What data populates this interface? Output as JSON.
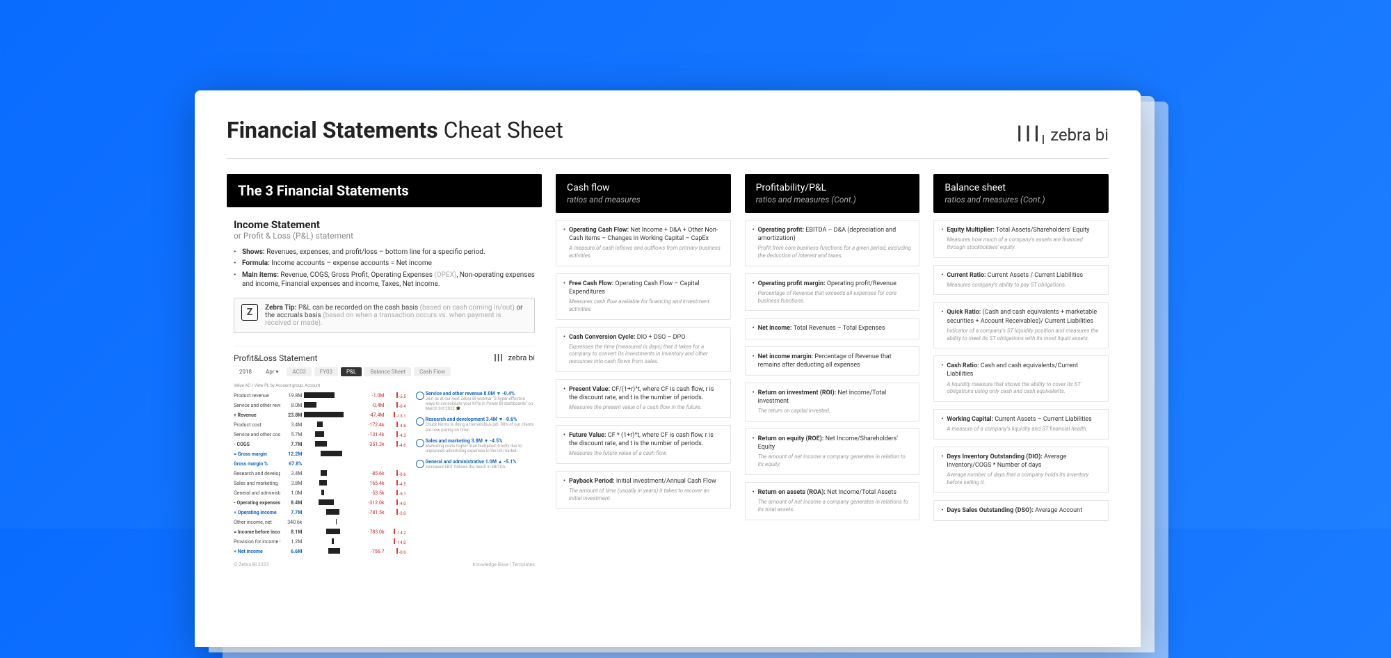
{
  "header": {
    "bold": "Financial Statements",
    "light": "Cheat Sheet"
  },
  "brand": "zebra bi",
  "left": {
    "bannerTitle": "The 3 Financial Statements",
    "incomeTitle": "Income Statement",
    "incomeAlt": "or Profit & Loss (P&L) statement",
    "b1Label": "Shows:",
    "b1Text": "Revenues, expenses, and profit/loss – bottom line for a specific period.",
    "b2Label": "Formula:",
    "b2Text": "Income accounts – expense accounts = Net income",
    "b3Label": "Main items:",
    "b3Text": "Revenue, COGS, Gross Profit, Operating Expenses ",
    "b3Dim": "(OPEX)",
    "b3Tail": ", Non-operating expenses and income, Financial expenses and income, Taxes, Net income.",
    "tipLabel": "Zebra Tip:",
    "tipText1": "P&L can be recorded on the cash basis ",
    "tipDim1": "(based on cash coming in/out)",
    "tipText2": " or the accruals basis ",
    "tipDim2": "(based on when a transaction occurs vs. when payment is received or made).",
    "chartTitle": "Profit&Loss Statement",
    "chartYear": "2018",
    "tabs": [
      "AC03",
      "FY03",
      "P&L",
      "Balance Sheet",
      "Cash Flow"
    ],
    "chartHdr": "Value AC / View PL by Account group, Account",
    "footerLeft": "© Zebra BI 2022",
    "footerRight": "Knowledge Base  |  Templates"
  },
  "tableRows": [
    {
      "label": "Product revenue",
      "ac": "19.8M",
      "bar": 55,
      "bpos": 0,
      "var": "-1.0M",
      "pct": "-5.5",
      "cls": "neg",
      "bold": false
    },
    {
      "label": "Service and other revenue",
      "ac": "8.0M",
      "bar": 22,
      "bpos": 0,
      "var": "-0.4M",
      "pct": "-0.4",
      "cls": "neg",
      "bold": false
    },
    {
      "label": "+ Revenue",
      "ac": "23.8M",
      "bar": 72,
      "bpos": 0,
      "var": "-47.4M",
      "pct": "-13.1",
      "cls": "neg",
      "bold": true
    },
    {
      "label": "Product cost",
      "ac": "3.4M",
      "bar": 10,
      "bpos": 24,
      "var": "-172.4k",
      "pct": "-4.8",
      "cls": "neg",
      "bold": false
    },
    {
      "label": "Service and other costs",
      "ac": "5.7M",
      "bar": 16,
      "bpos": 20,
      "var": "-131.4k",
      "pct": "-4.3",
      "cls": "neg",
      "bold": false
    },
    {
      "label": "- COGS",
      "ac": "7.7M",
      "bar": 22,
      "bpos": 20,
      "var": "-351.3k",
      "pct": "-4.6",
      "cls": "neg",
      "bold": true
    },
    {
      "label": "= Gross margin",
      "ac": "12.2M",
      "bar": 40,
      "bpos": 30,
      "var": "",
      "pct": "",
      "cls": "",
      "bold": true,
      "blue": true
    },
    {
      "label": "Gross margin %",
      "ac": "67.8%",
      "bar": 0,
      "bpos": 0,
      "var": "",
      "pct": "",
      "cls": "",
      "bold": false,
      "blue": true
    },
    {
      "label": "Research and development",
      "ac": "3.4M",
      "bar": 12,
      "bpos": 30,
      "var": "-85.6k",
      "pct": "-0.6",
      "cls": "neg",
      "bold": false
    },
    {
      "label": "Sales and marketing",
      "ac": "3.8M",
      "bar": 13,
      "bpos": 28,
      "var": "165.4k",
      "pct": "-4.5",
      "cls": "neg",
      "bold": false
    },
    {
      "label": "General and administrative",
      "ac": "1.0M",
      "bar": 4,
      "bpos": 32,
      "var": "-53.5k",
      "pct": "-5.1",
      "cls": "neg",
      "bold": false
    },
    {
      "label": "- Operating expenses",
      "ac": "8.4M",
      "bar": 28,
      "bpos": 26,
      "var": "-312.0k",
      "pct": "-4.0",
      "cls": "neg",
      "bold": true
    },
    {
      "label": "= Operating income",
      "ac": "7.7M",
      "bar": 24,
      "bpos": 40,
      "var": "-781.5k",
      "pct": "-2.0",
      "cls": "neg",
      "bold": true,
      "blue": true
    },
    {
      "label": "Other income, net",
      "ac": "340.6k",
      "bar": 2,
      "bpos": 58,
      "var": "",
      "pct": "",
      "cls": "",
      "bold": false
    },
    {
      "label": "= Income before income taxes",
      "ac": "8.1M",
      "bar": 26,
      "bpos": 40,
      "var": "-783.0k",
      "pct": "-14.2",
      "cls": "neg",
      "bold": true
    },
    {
      "label": "Provision for income taxes",
      "ac": "1.2M",
      "bar": 4,
      "bpos": 50,
      "var": "",
      "pct": "-14.0",
      "cls": "neg",
      "bold": false
    },
    {
      "label": "= Net income",
      "ac": "6.6M",
      "bar": 22,
      "bpos": 44,
      "var": "-756.7",
      "pct": "-0.6",
      "cls": "neg",
      "bold": true,
      "blue": true
    }
  ],
  "annotations": [
    {
      "t": "Service and other revenue 8.0M ▼ -0.4%",
      "d": "Join us at our next Zebra BI webinar \"3 hyper-effective ways to consolidate your KPIs in Power BI dashboards\" on March 3rd 2022 🎓"
    },
    {
      "t": "Research and development 3.4M ▼ -0.6%",
      "d": "Chuck Norris is doing a tremendous job. 98% of our clients are now paying on time!"
    },
    {
      "t": "Sales and marketing 3.8M ▼ -4.5%",
      "d": "Marketing costs higher than budgeted mostly due to unplanned advertising expenses in the US market."
    },
    {
      "t": "General and administrative 1.0M ▲ -5.1%",
      "d": "Increased EBIT follows the result in EBITDA."
    }
  ],
  "col2": {
    "title": "Cash flow",
    "sub": "ratios and measures",
    "cards": [
      {
        "term": "Operating Cash Flow:",
        "def": "Net Income + D&A + Other Non-Cash items – Changes in Working Capital – CapEx",
        "desc": "A measure of cash inflows and outflows from primary business activities."
      },
      {
        "term": "Free Cash Flow:",
        "def": "Operating Cash Flow – Capital Expenditures",
        "desc": "Measures cash flow available for financing and investment activities."
      },
      {
        "term": "Cash Conversion Cycle:",
        "def": "DIO + DSO – DPO",
        "desc": "Expresses the time (measured in days) that it takes for a company to convert its investments in inventory and other resources into cash flows from sales."
      },
      {
        "term": "Present Value:",
        "def": "CF/(1+r)^t, where CF is cash flow, r is the discount rate, and t is the number of periods.",
        "desc": "Measures the present value of a cash flow in the future."
      },
      {
        "term": "Future Value:",
        "def": "CF * (1+r)^t, where CF is cash flow, r is the discount rate, and t is the number of periods.",
        "desc": "Measures the future value of a cash flow."
      },
      {
        "term": "Payback Period:",
        "def": "Initial investment/Annual Cash Flow",
        "desc": "The amount of time (usually in years) it takes to recover an initial investment."
      }
    ]
  },
  "col3": {
    "title": "Profitability/P&L",
    "sub": "ratios and measures (Cont.)",
    "cards": [
      {
        "term": "Operating profit:",
        "def": "EBITDA – D&A (depreciation and amortization)",
        "desc": "Profit from core business functions for a given period, excluding the deduction of interest and taxes."
      },
      {
        "term": "Operating profit margin:",
        "def": "Operating profit/Revenue",
        "desc": "Percentage of Revenue that exceeds all expenses for core business functions."
      },
      {
        "term": "Net income:",
        "def": "Total Revenues – Total Expenses",
        "desc": ""
      },
      {
        "term": "Net income margin:",
        "def": "Percentage of Revenue that remains after deducting all expenses",
        "desc": ""
      },
      {
        "term": "Return on investment (ROI):",
        "def": "Net income/Total investment",
        "desc": "The return on capital invested."
      },
      {
        "term": "Return on equity (ROE):",
        "def": "Net Income/Shareholders' Equity",
        "desc": "The amount of net income a company generates in relation to its equity."
      },
      {
        "term": "Return on assets (ROA):",
        "def": "Net Income/Total Assets",
        "desc": "The amount of net income a company generates in relations to its total assets."
      }
    ]
  },
  "col4": {
    "title": "Balance sheet",
    "sub": "ratios and measures (Cont.)",
    "cards": [
      {
        "term": "Equity Multiplier:",
        "def": "Total Assets/Shareholders' Equity",
        "desc": "Measures how much of a company's assets are financed through stockholders' equity."
      },
      {
        "term": "Current Ratio:",
        "def": "Current Assets / Current Liabilities",
        "desc": "Measures company's ability to pay ST obligations."
      },
      {
        "term": "Quick Ratio:",
        "def": "(Cash and cash equivalents + marketable securities + Account Receivables)/ Current Liabilities",
        "desc": "Indicator of a company's ST liquidity position and measures the ability to meet its ST obligations with its most liquid assets."
      },
      {
        "term": "Cash Ratio:",
        "def": "Cash and cash equivalents/Current Liabilities",
        "desc": "A liquidity measure that shows the ability to cover its ST obligations using only cash and cash equivalents."
      },
      {
        "term": "Working Capital:",
        "def": "Current Assets – Current Liabilities",
        "desc": "A measure of a company's liquidity and ST financial health."
      },
      {
        "term": "Days Inventory Outstanding (DIO):",
        "def": "Average Inventory/COGS * Number of days",
        "desc": "Average number of days that a company holds its inventory before selling it."
      },
      {
        "term": "Days Sales Outstanding (DSO):",
        "def": "Average Account",
        "desc": ""
      }
    ]
  }
}
